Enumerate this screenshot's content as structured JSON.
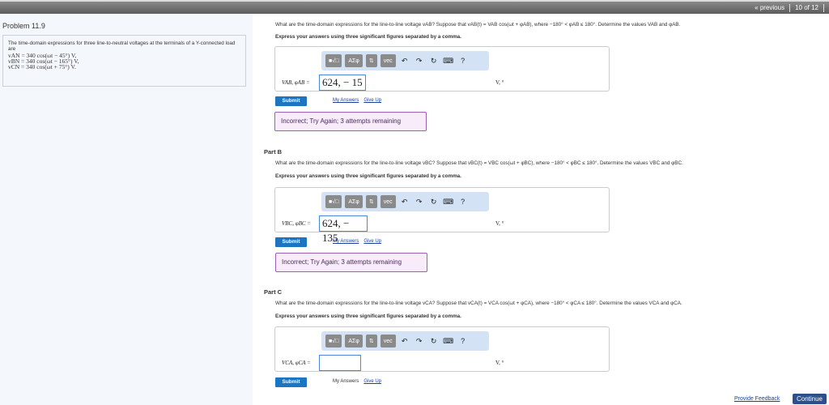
{
  "nav": {
    "previous": "« previous",
    "position": "10 of 12"
  },
  "problem": {
    "title": "Problem 11.9",
    "intro": "The time-domain expressions for three line-to-neutral voltages at the terminals of a Y-connected load are",
    "eqs": [
      "vAN = 340 cos(ωt − 45°) V,",
      "vBN = 340 cos(ωt − 165°) V,",
      "vCN = 340 cos(ωt + 75°) V."
    ]
  },
  "toolbar": {
    "templates": "■√□",
    "greek": "ΑΣφ",
    "arrows": "⇅",
    "vec": "vec",
    "undo": "↶",
    "redo": "↷",
    "reset": "↻",
    "keyboard": "⌨",
    "help": "?"
  },
  "parts": [
    {
      "label": "",
      "question": "What are the time-domain expressions for the line-to-line voltage vAB? Suppose that vAB(t) = VAB cos(ωt + φAB), where −180° < φAB ≤ 180°. Determine the values VAB and φAB.",
      "instruction": "Express your answers using three significant figures separated by a comma.",
      "input_label": "VAB, φAB =",
      "value": "624, − 15",
      "unit": "V, °",
      "submit": "Submit",
      "my_answers": "My Answers",
      "give_up": "Give Up",
      "feedback": "Incorrect; Try Again; 3 attempts remaining"
    },
    {
      "label": "Part B",
      "question": "What are the time-domain expressions for the line-to-line voltage vBC? Suppose that vBC(t) = VBC cos(ωt + φBC), where −180° < φBC ≤ 180°. Determine the values VBC and φBC.",
      "instruction": "Express your answers using three significant figures separated by a comma.",
      "input_label": "VBC, φBC =",
      "value": "624, − 135",
      "unit": "V, °",
      "submit": "Submit",
      "my_answers": "My Answers",
      "give_up": "Give Up",
      "feedback": "Incorrect; Try Again; 3 attempts remaining"
    },
    {
      "label": "Part C",
      "question": "What are the time-domain expressions for the line-to-line voltage vCA? Suppose that vCA(t) = VCA cos(ωt + φCA), where −180° < φCA ≤ 180°. Determine the values VCA and φCA.",
      "instruction": "Express your answers using three significant figures separated by a comma.",
      "input_label": "VCA, φCA =",
      "value": "",
      "unit": "V, °",
      "submit": "Submit",
      "my_answers": "My Answers",
      "give_up": "Give Up"
    }
  ],
  "footer": {
    "feedback": "Provide Feedback",
    "continue": "Continue"
  }
}
